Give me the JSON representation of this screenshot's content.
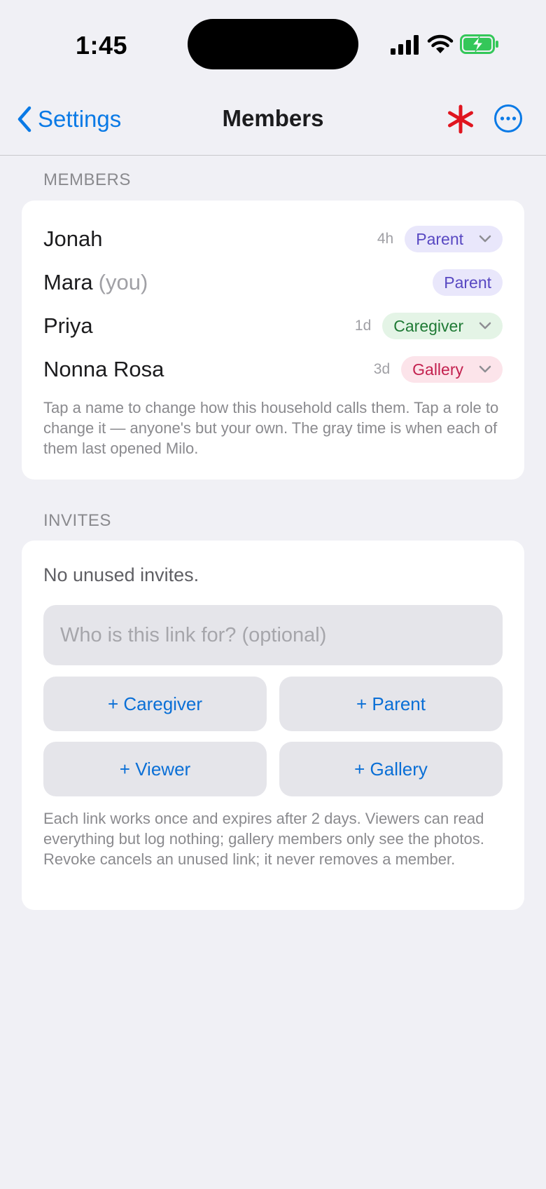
{
  "status_bar": {
    "time": "1:45"
  },
  "nav": {
    "back_label": "Settings",
    "title": "Members"
  },
  "colors": {
    "accent": "#0a7ae6",
    "asterisk": "#e0151f"
  },
  "members_section": {
    "header": "MEMBERS",
    "members": [
      {
        "name": "Jonah",
        "suffix": "",
        "last_seen": "4h",
        "role": "Parent"
      },
      {
        "name": "Mara",
        "suffix": "(you)",
        "last_seen": "",
        "role": "Parent"
      },
      {
        "name": "Priya",
        "suffix": "",
        "last_seen": "1d",
        "role": "Caregiver"
      },
      {
        "name": "Nonna Rosa",
        "suffix": "",
        "last_seen": "3d",
        "role": "Gallery"
      }
    ],
    "footnote": "Tap a name to change how this household calls them. Tap a role to change it — anyone's but your own. The gray time is when each of them last opened Milo."
  },
  "invites_section": {
    "header": "INVITES",
    "empty_text": "No unused invites.",
    "input_placeholder": "Who is this link for? (optional)",
    "input_value": "",
    "buttons": {
      "caregiver": "+ Caregiver",
      "parent": "+ Parent",
      "viewer": "+ Viewer",
      "gallery": "+ Gallery"
    },
    "footnote": "Each link works once and expires after 2 days. Viewers can read everything but log nothing; gallery members only see the photos. Revoke cancels an unused link; it never removes a member."
  }
}
